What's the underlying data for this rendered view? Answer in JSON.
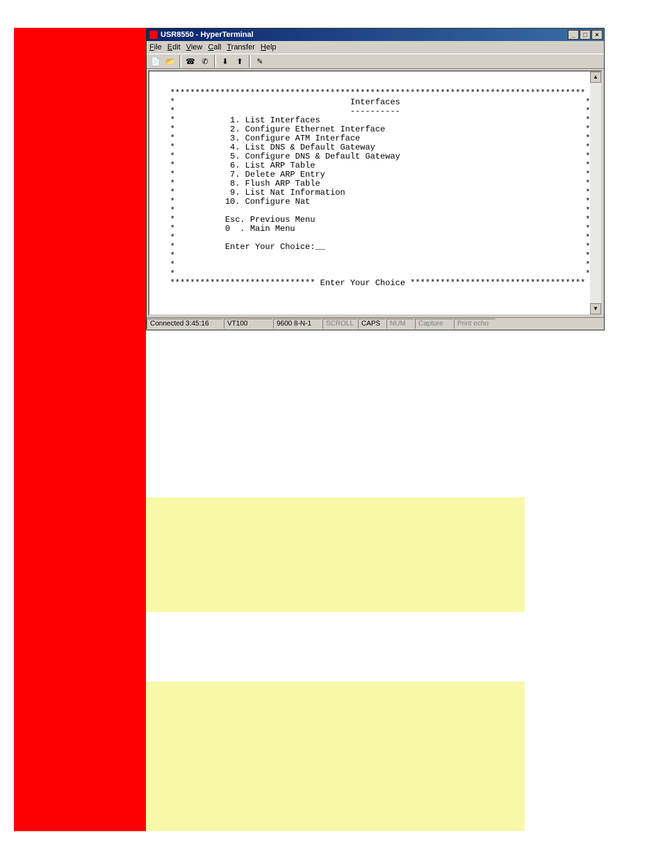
{
  "window": {
    "title": "USR8550 - HyperTerminal",
    "controls": {
      "min": "_",
      "max": "□",
      "close": "×"
    }
  },
  "menus": {
    "file": "File",
    "edit": "Edit",
    "view": "View",
    "call": "Call",
    "transfer": "Transfer",
    "help": "Help"
  },
  "toolbar_icons": {
    "new": "new-icon",
    "open": "open-icon",
    "connect": "connect-icon",
    "disconnect": "disconnect-icon",
    "send": "send-icon",
    "receive": "receive-icon",
    "properties": "properties-icon"
  },
  "terminal": {
    "stars_top": "   ***********************************************************************************",
    "title": "   *                                   Interfaces                                     *",
    "underline": "   *                                   ----------                                     *",
    "items": [
      "   *           1. List Interfaces                                                     *",
      "   *           2. Configure Ethernet Interface                                        *",
      "   *           3. Configure ATM Interface                                             *",
      "   *           4. List DNS & Default Gateway                                          *",
      "   *           5. Configure DNS & Default Gateway                                     *",
      "   *           6. List ARP Table                                                      *",
      "   *           7. Delete ARP Entry                                                    *",
      "   *           8. Flush ARP Table                                                     *",
      "   *           9. List Nat Information                                                *",
      "   *          10. Configure Nat                                                       *"
    ],
    "blank": "   *                                                                                  *",
    "esc": "   *          Esc. Previous Menu                                                      *",
    "zero": "   *          0  . Main Menu                                                          *",
    "prompt": "   *          Enter Your Choice:__                                                    *",
    "stars_mid": "   ***************************** Enter Your Choice ***********************************"
  },
  "status": {
    "connected": "Connected 3:45:16",
    "emulation": "VT100",
    "settings": "9600 8-N-1",
    "scroll": "SCROLL",
    "caps": "CAPS",
    "num": "NUM",
    "capture": "Capture",
    "echo": "Print echo"
  }
}
